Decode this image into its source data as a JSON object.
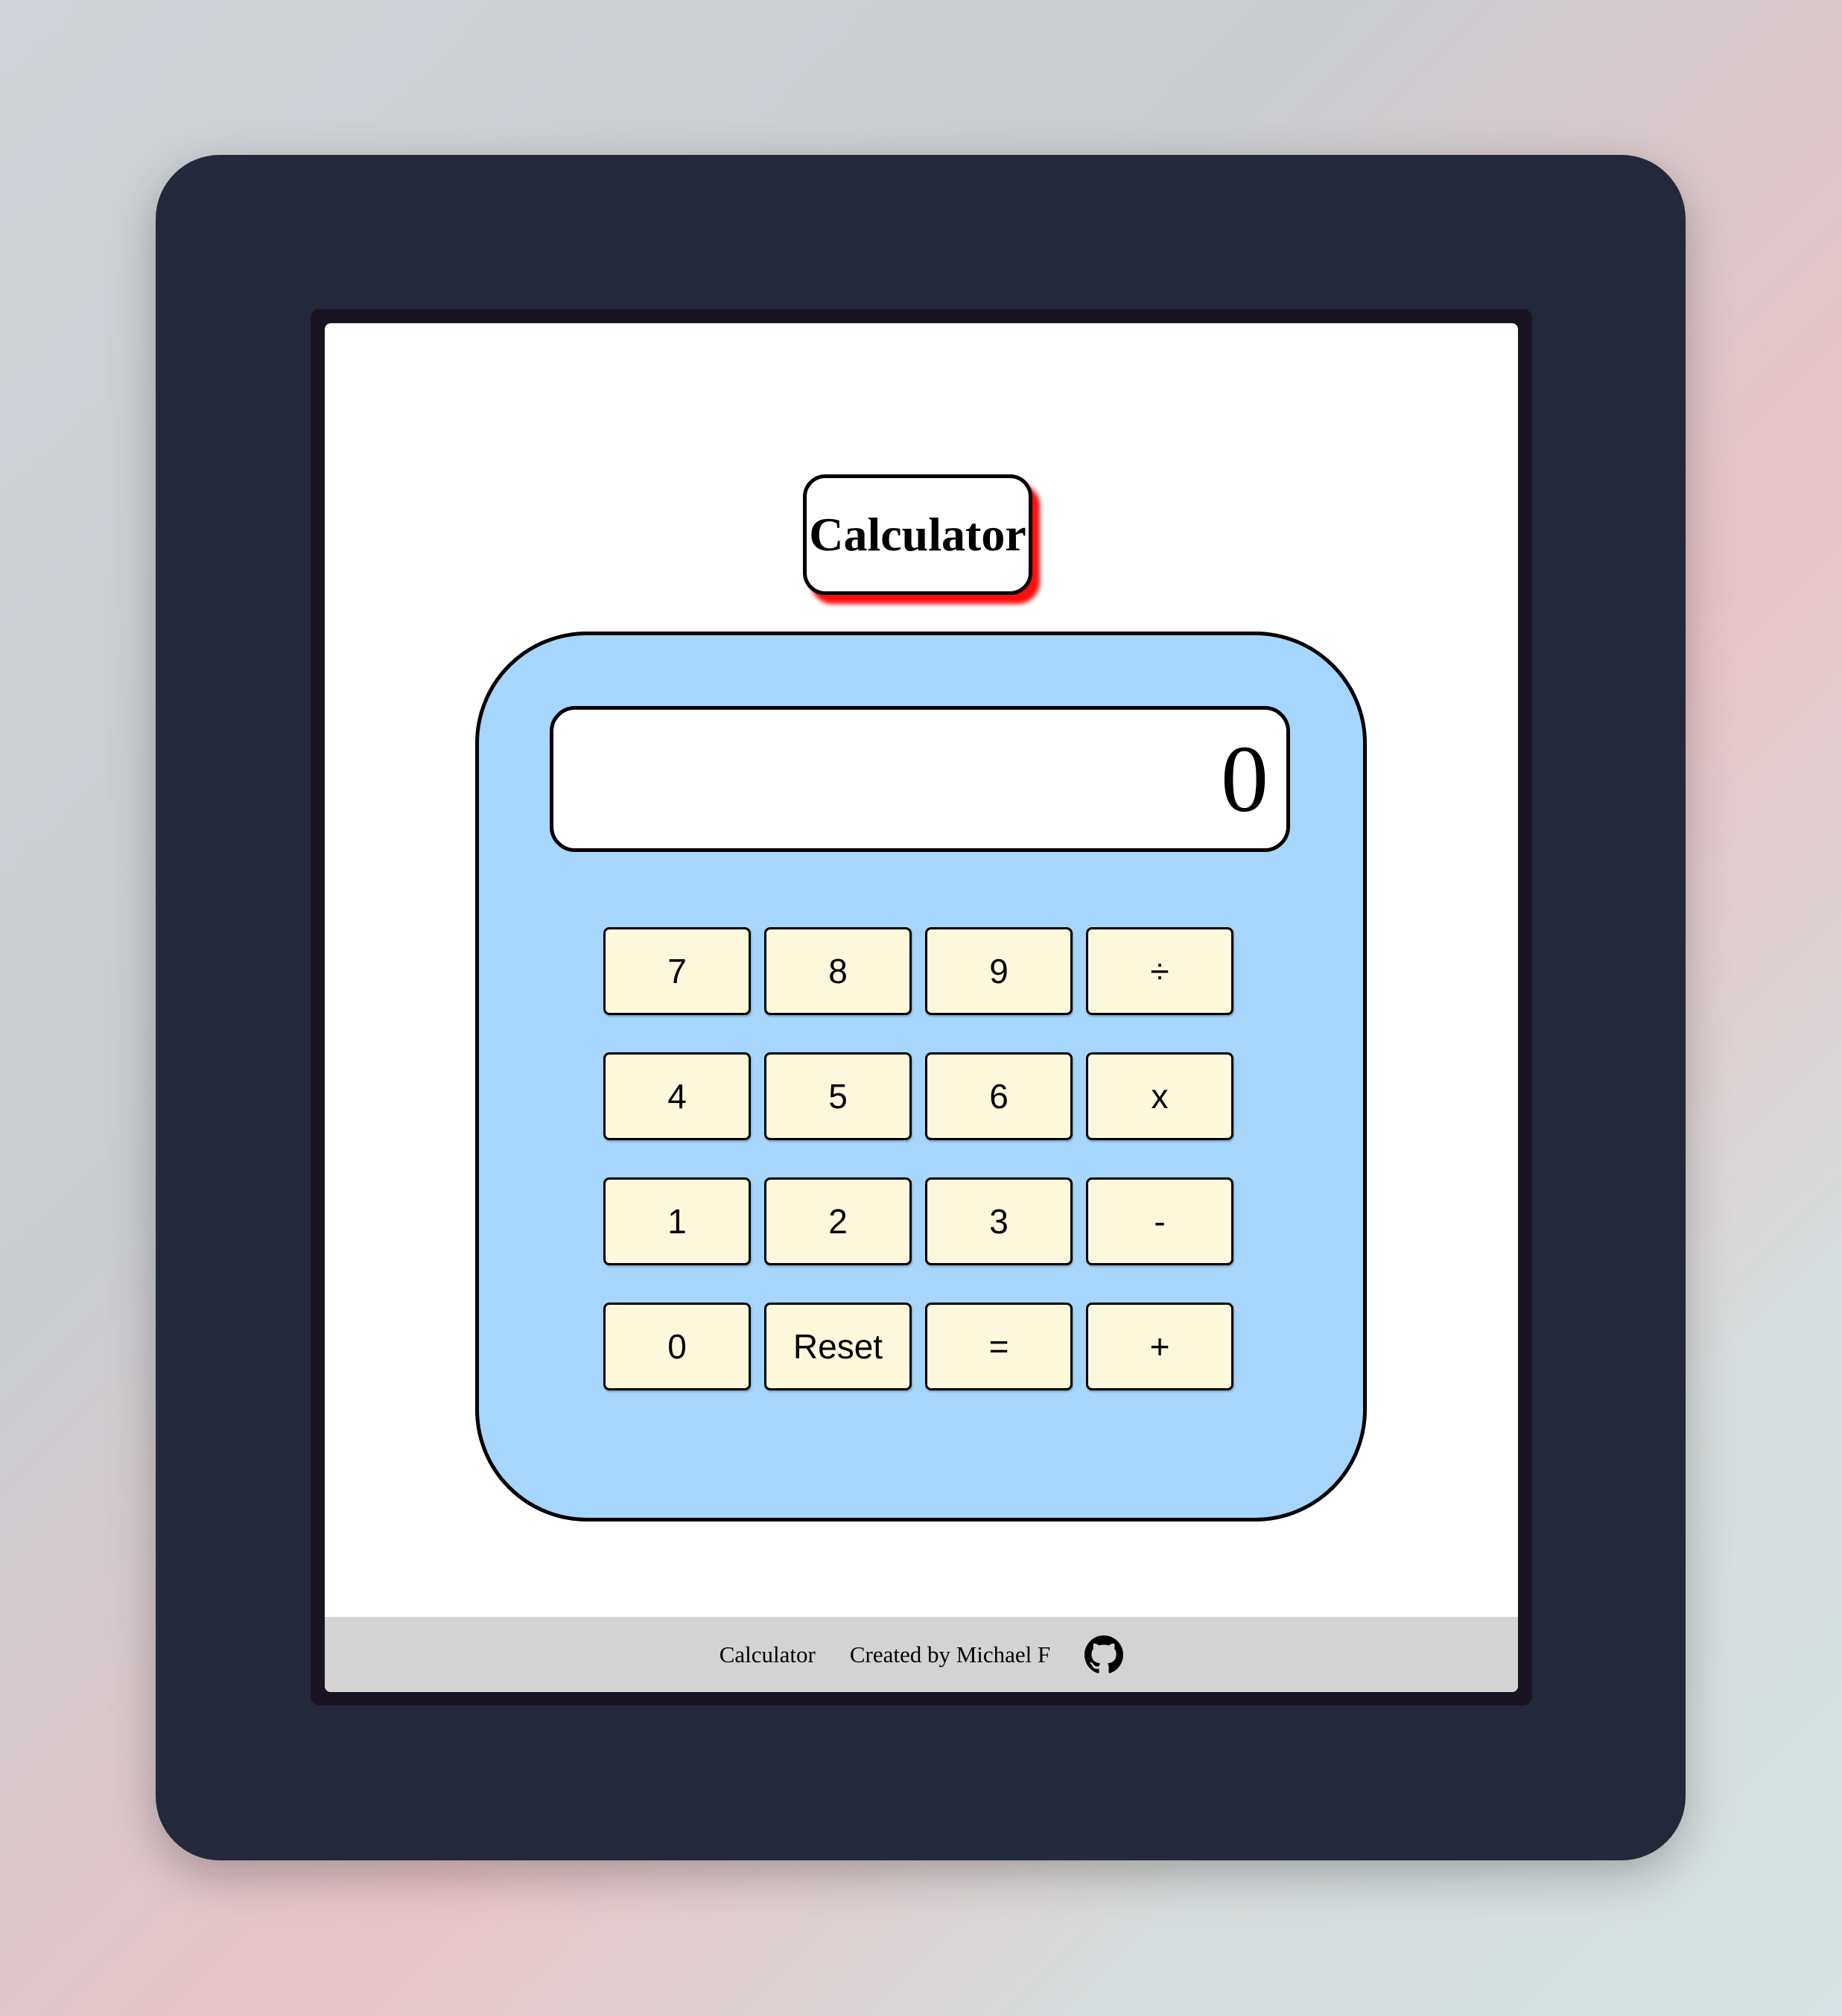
{
  "app": {
    "title": "Calculator"
  },
  "display": {
    "value": "0"
  },
  "keypad": {
    "keys": [
      "7",
      "8",
      "9",
      "÷",
      "4",
      "5",
      "6",
      "x",
      "1",
      "2",
      "3",
      "-",
      "0",
      "Reset",
      "=",
      "+"
    ]
  },
  "footer": {
    "app_name": "Calculator",
    "credit": "Created by Michael F",
    "icon": "github-icon"
  },
  "colors": {
    "calculator_body": "#a6d6fc",
    "key_background": "#fdf8dc",
    "title_shadow": "#ff0000",
    "footer_background": "#d3d3d3",
    "device_frame": "#23283b"
  }
}
